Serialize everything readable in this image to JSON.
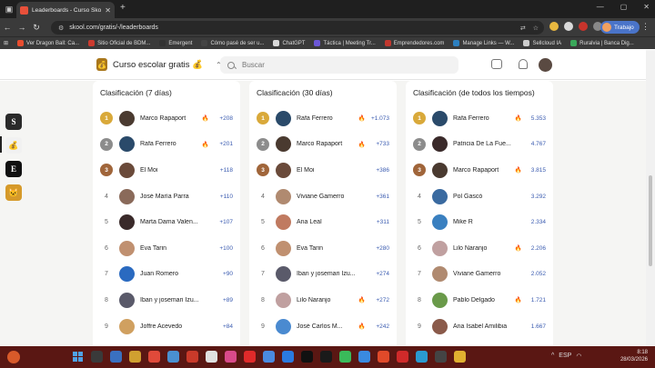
{
  "browser": {
    "tab_title": "Leaderboards - Curso Skool Gra...",
    "tab_close": "✕",
    "new_tab": "+",
    "url": "skool.com/gratis/-/leaderboards",
    "profile_label": "Trabajo",
    "bookmarks": [
      {
        "label": "Ver Dragon Ball: Ca...",
        "color": "#e84d2f"
      },
      {
        "label": "Sitio Oficial de BDM...",
        "color": "#cc3b2f"
      },
      {
        "label": "Emergent",
        "color": "#333333"
      },
      {
        "label": "Cómo pasé de ser u...",
        "color": "#444444"
      },
      {
        "label": "ChatGPT",
        "color": "#d9d9d9"
      },
      {
        "label": "Táctica | Meeting Tr...",
        "color": "#6b57d6"
      },
      {
        "label": "Emprendedores.com",
        "color": "#c2382f"
      },
      {
        "label": "Manage Links — W...",
        "color": "#2c7fbf"
      },
      {
        "label": "Sellcloud IA",
        "color": "#cccccc"
      },
      {
        "label": "Ruralvia | Banca Dig...",
        "color": "#3aa85a"
      }
    ]
  },
  "header": {
    "group_name": "Curso escolar gratis 💰",
    "group_icon": "💰",
    "chevron": "⌃⌄",
    "search_placeholder": "Buscar"
  },
  "leaderboards": [
    {
      "title": "Clasificación (7 días)",
      "rows": [
        {
          "rank": "1",
          "name": "Marco  Rapaport",
          "fire": true,
          "points": "+208",
          "color": "#4a3a30"
        },
        {
          "rank": "2",
          "name": "Rafa  Ferrero",
          "fire": true,
          "points": "+201",
          "color": "#2a4a6a"
        },
        {
          "rank": "3",
          "name": "El  Moi",
          "fire": false,
          "points": "+118",
          "color": "#6a4a3a"
        },
        {
          "rank": "4",
          "name": "José María  Parra",
          "fire": false,
          "points": "+110",
          "color": "#8a6a5a"
        },
        {
          "rank": "5",
          "name": "Marta  Dama Valen...",
          "fire": false,
          "points": "+107",
          "color": "#3a2a2a"
        },
        {
          "rank": "6",
          "name": "Eva  Tarin",
          "fire": false,
          "points": "+100",
          "color": "#c09070"
        },
        {
          "rank": "7",
          "name": "Juan  Romero",
          "fire": false,
          "points": "+90",
          "color": "#2a6ac0"
        },
        {
          "rank": "8",
          "name": "Iban y josemari  Izu...",
          "fire": false,
          "points": "+89",
          "color": "#5a5a6a"
        },
        {
          "rank": "9",
          "name": "Joffre  Acevedo",
          "fire": false,
          "points": "+84",
          "color": "#d0a060"
        }
      ]
    },
    {
      "title": "Clasificación (30 días)",
      "rows": [
        {
          "rank": "1",
          "name": "Rafa  Ferrero",
          "fire": true,
          "points": "+1.073",
          "color": "#2a4a6a"
        },
        {
          "rank": "2",
          "name": "Marco  Rapaport",
          "fire": true,
          "points": "+733",
          "color": "#4a3a30"
        },
        {
          "rank": "3",
          "name": "El  Moi",
          "fire": false,
          "points": "+386",
          "color": "#6a4a3a"
        },
        {
          "rank": "4",
          "name": "Viviane  Gamerro",
          "fire": false,
          "points": "+361",
          "color": "#b08a70"
        },
        {
          "rank": "5",
          "name": "Ana  Leal",
          "fire": false,
          "points": "+311",
          "color": "#c07a60"
        },
        {
          "rank": "6",
          "name": "Eva  Tarin",
          "fire": false,
          "points": "+280",
          "color": "#c09070"
        },
        {
          "rank": "7",
          "name": "Iban y josemari  Izu...",
          "fire": false,
          "points": "+274",
          "color": "#5a5a6a"
        },
        {
          "rank": "8",
          "name": "Lilo  Naranjo",
          "fire": true,
          "points": "+272",
          "color": "#c0a0a0"
        },
        {
          "rank": "9",
          "name": "José Carlos  M...",
          "fire": true,
          "points": "+242",
          "color": "#4a8ad0"
        }
      ]
    },
    {
      "title": "Clasificación (de todos los tiempos)",
      "rows": [
        {
          "rank": "1",
          "name": "Rafa  Ferrero",
          "fire": true,
          "points": "5.353",
          "color": "#2a4a6a"
        },
        {
          "rank": "2",
          "name": "Patricia  De La Fue...",
          "fire": false,
          "points": "4.767",
          "color": "#3a2a2a"
        },
        {
          "rank": "3",
          "name": "Marco  Rapaport",
          "fire": true,
          "points": "3.815",
          "color": "#4a3a30"
        },
        {
          "rank": "4",
          "name": "Pol  Gascó",
          "fire": false,
          "points": "3.292",
          "color": "#3a6aa0"
        },
        {
          "rank": "5",
          "name": "Mike  R",
          "fire": false,
          "points": "2.334",
          "color": "#3a80c0"
        },
        {
          "rank": "6",
          "name": "Lilo  Naranjo",
          "fire": true,
          "points": "2.206",
          "color": "#c0a0a0"
        },
        {
          "rank": "7",
          "name": "Viviane  Gamerro",
          "fire": false,
          "points": "2.052",
          "color": "#b08a70"
        },
        {
          "rank": "8",
          "name": "Pablo  Delgado",
          "fire": true,
          "points": "1.721",
          "color": "#6a9a4a"
        },
        {
          "rank": "9",
          "name": "Ana Isabel  Amilibia",
          "fire": false,
          "points": "1.667",
          "color": "#8a5a4a"
        }
      ]
    }
  ],
  "medal_colors": {
    "1": "#d9a93a",
    "2": "#8c8c8c",
    "3": "#a0653a"
  },
  "fire_glyph": "🔥",
  "left_rail": [
    {
      "name": "brand-badge-icon",
      "color": "#2a2a2a",
      "glyph": "S"
    },
    {
      "name": "money-bag-icon",
      "color": "#f1f1f1",
      "glyph": "💰"
    },
    {
      "name": "letter-e-icon",
      "color": "#111111",
      "glyph": "E"
    },
    {
      "name": "cat-avatar-icon",
      "color": "#d69a2a",
      "glyph": "🐱"
    }
  ],
  "taskbar": {
    "time": "8:18",
    "date": "28/03/2026",
    "tray_label": "ESP"
  }
}
